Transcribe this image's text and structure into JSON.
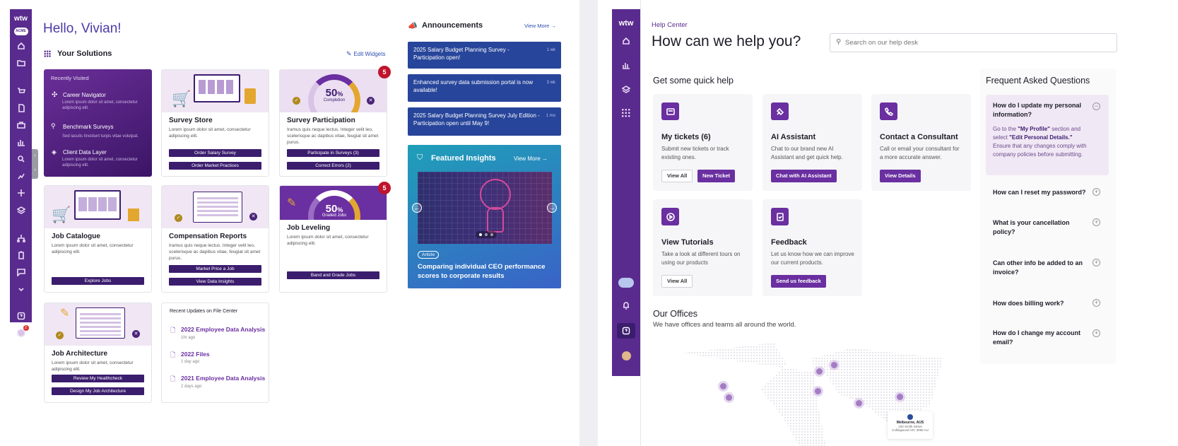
{
  "left": {
    "sidebar": {
      "logo": "wtw",
      "org": "ACME",
      "alert_count": "2"
    },
    "greeting": "Hello, Vivian!",
    "solutions": {
      "title": "Your Solutions",
      "edit_label": "Edit Widgets"
    },
    "recently_visited": {
      "title": "Recently Visited",
      "items": [
        {
          "label": "Career Navigator",
          "desc": "Lorem ipsum dolor sit amet, consectetur adipiscing elit."
        },
        {
          "label": "Benchmark Surveys",
          "desc": "Sed iaculis tincidunt turpis vitae volutpat."
        },
        {
          "label": "Client Data Layer",
          "desc": "Lorem ipsum dolor sit amet, consectetur adipiscing elit."
        }
      ]
    },
    "survey_store": {
      "title": "Survey Store",
      "desc": "Lorem ipsum dolor sit amet, consectetur adipiscing elit.",
      "btn1": "Order Salary Survey",
      "btn2": "Order Market Practices"
    },
    "survey_participation": {
      "title": "Survey Participation",
      "badge": "5",
      "gauge_value": "50",
      "gauge_unit": "%",
      "gauge_label": "Completion",
      "desc": "Iramus quis neque lectus. Integer velit leo, scelerisque ac dapibus vitae, feugiat sit amet purus.",
      "btn1": "Participate in Surveys (3)",
      "btn2": "Correct Errors (2)"
    },
    "job_catalogue": {
      "title": "Job Catalogue",
      "desc": "Lorem ipsum dolor sit amet, consectetur adipiscing elit.",
      "btn1": "Explore Jobs"
    },
    "compensation_reports": {
      "title": "Compensation Reports",
      "desc": "Iramus quis neque lectus. Integer velit leo, scelerisque ac dapibus vitae, feugiat sit amet purus.",
      "btn1": "Market Price a Job",
      "btn2": "View Data Insights"
    },
    "job_leveling": {
      "title": "Job Leveling",
      "badge": "5",
      "gauge_value": "50",
      "gauge_unit": "%",
      "gauge_label": "Graded Jobs",
      "desc": "Lorem ipsum dolor sit amet, consectetur adipiscing elit.",
      "btn1": "Band and Grade Jobs"
    },
    "job_architecture": {
      "title": "Job Architecture",
      "desc": "Lorem ipsum dolor sit amet, consectetur adipiscing elit.",
      "btn1": "Review My Healthcheck",
      "btn2": "Design My Job Architecture"
    },
    "file_center": {
      "title": "Recent Updates on File Center",
      "items": [
        {
          "name": "2022 Employee Data Analysis",
          "time": "1hr ago"
        },
        {
          "name": "2022 Files",
          "time": "1 day ago"
        },
        {
          "name": "2021 Employee Data Analysis",
          "time": "2 days ago"
        }
      ]
    },
    "announcements": {
      "title": "Announcements",
      "view_more": "View More",
      "items": [
        {
          "text": "2025 Salary Budget Planning Survey - Participation open!",
          "time": "1 wk"
        },
        {
          "text": "Enhanced survey data submission portal is now available!",
          "time": "3 wk"
        },
        {
          "text": "2025 Salary Budget Planning Survey July Edition - Participation open until May 9!",
          "time": "1 mo"
        }
      ]
    },
    "insights": {
      "title": "Featured Insights",
      "view_more": "View More",
      "tag": "Article",
      "caption": "Comparing individual CEO performance scores to corporate results"
    }
  },
  "right": {
    "sidebar": {
      "logo": "wtw"
    },
    "breadcrumb": "Help Center",
    "title": "How can we help you?",
    "search_placeholder": "Search on our help desk",
    "quick_help": {
      "title": "Get some quick help",
      "cards": [
        {
          "title": "My tickets (6)",
          "desc": "Submit new tickets or track existing ones.",
          "btn1": "View All",
          "btn2": "New Ticket",
          "icon": "ticket-icon"
        },
        {
          "title": "AI Assistant",
          "desc": "Chat to our brand new AI Assistant and get quick help.",
          "btn1": "Chat with AI Assistant",
          "icon": "ai-icon"
        },
        {
          "title": "Contact a Consultant",
          "desc": "Call or email your consultant for a more accurate answer.",
          "btn1": "View Details",
          "icon": "phone-icon"
        },
        {
          "title": "View Tutorials",
          "desc": "Take a look at different tours on using our products",
          "btn1": "View All",
          "icon": "play-icon"
        },
        {
          "title": "Feedback",
          "desc": "Let us know how we can improve our current products.",
          "btn1": "Send us feedback",
          "icon": "feedback-icon"
        }
      ]
    },
    "faq": {
      "title": "Frequent Asked Questions",
      "items": [
        {
          "q": "How do I update my personal information?",
          "a_pre": "Go to the ",
          "a_b1": "\"My Profile\"",
          "a_mid": " section and select ",
          "a_b2": "\"Edit Personal Details.\"",
          "a_post": " Ensure that any changes comply with company policies before submitting."
        },
        {
          "q": "How can I reset my password?"
        },
        {
          "q": "What is your cancellation policy?"
        },
        {
          "q": "Can other info be added to an invoice?"
        },
        {
          "q": "How does billing work?"
        },
        {
          "q": "How do I change my account email?"
        }
      ]
    },
    "offices": {
      "title": "Our Offices",
      "subtitle": "We have offices and teams all around the world.",
      "popup_title": "Melbourne, AUS",
      "popup_line1": "100 Smith Street",
      "popup_line2": "Collingwood VIC 3066 AU"
    }
  }
}
